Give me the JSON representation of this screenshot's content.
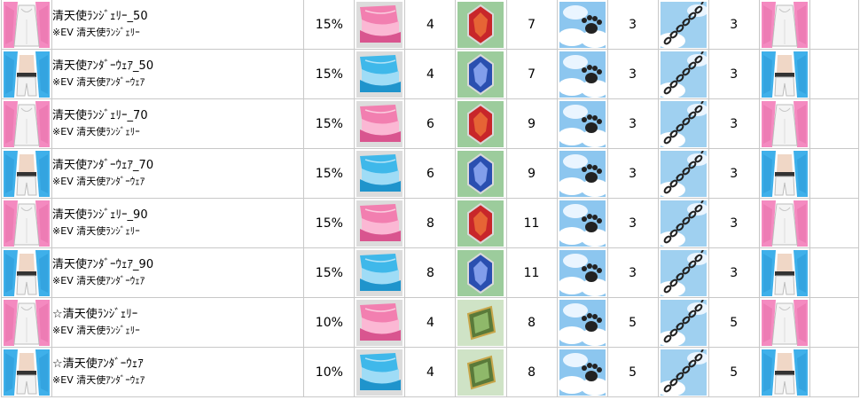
{
  "rows": [
    {
      "outfit": "pink-lingerie",
      "name": "清天使ﾗﾝｼﾞｪﾘｰ_50",
      "note": "※EV 清天使ﾗﾝｼﾞｪﾘｰ",
      "rate": "15%",
      "cloth": "pink",
      "cloth_qty": "4",
      "gem": "red",
      "gem_qty": "7",
      "paw_qty": "3",
      "chain_qty": "3"
    },
    {
      "outfit": "blue-underwear",
      "name": "清天使ｱﾝﾀﾞｰｳｪｱ_50",
      "note": "※EV 清天使ｱﾝﾀﾞｰｳｪｱ",
      "rate": "15%",
      "cloth": "blue",
      "cloth_qty": "4",
      "gem": "blue",
      "gem_qty": "7",
      "paw_qty": "3",
      "chain_qty": "3"
    },
    {
      "outfit": "pink-lingerie",
      "name": "清天使ﾗﾝｼﾞｪﾘｰ_70",
      "note": "※EV 清天使ﾗﾝｼﾞｪﾘｰ",
      "rate": "15%",
      "cloth": "pink",
      "cloth_qty": "6",
      "gem": "red",
      "gem_qty": "9",
      "paw_qty": "3",
      "chain_qty": "3"
    },
    {
      "outfit": "blue-underwear",
      "name": "清天使ｱﾝﾀﾞｰｳｪｱ_70",
      "note": "※EV 清天使ｱﾝﾀﾞｰｳｪｱ",
      "rate": "15%",
      "cloth": "blue",
      "cloth_qty": "6",
      "gem": "blue",
      "gem_qty": "9",
      "paw_qty": "3",
      "chain_qty": "3"
    },
    {
      "outfit": "pink-lingerie",
      "name": "清天使ﾗﾝｼﾞｪﾘｰ_90",
      "note": "※EV 清天使ﾗﾝｼﾞｪﾘｰ",
      "rate": "15%",
      "cloth": "pink",
      "cloth_qty": "8",
      "gem": "red",
      "gem_qty": "11",
      "paw_qty": "3",
      "chain_qty": "3"
    },
    {
      "outfit": "blue-underwear",
      "name": "清天使ｱﾝﾀﾞｰｳｪｱ_90",
      "note": "※EV 清天使ｱﾝﾀﾞｰｳｪｱ",
      "rate": "15%",
      "cloth": "blue",
      "cloth_qty": "8",
      "gem": "blue",
      "gem_qty": "11",
      "paw_qty": "3",
      "chain_qty": "3"
    },
    {
      "outfit": "pink-lingerie",
      "name": "☆清天使ﾗﾝｼﾞｪﾘｰ",
      "note": "※EV 清天使ﾗﾝｼﾞｪﾘｰ",
      "rate": "10%",
      "cloth": "pink",
      "cloth_qty": "4",
      "gem": "green",
      "gem_qty": "8",
      "paw_qty": "5",
      "chain_qty": "5"
    },
    {
      "outfit": "blue-underwear",
      "name": "☆清天使ｱﾝﾀﾞｰｳｪｱ",
      "note": "※EV 清天使ｱﾝﾀﾞｰｳｪｱ",
      "rate": "10%",
      "cloth": "blue",
      "cloth_qty": "4",
      "gem": "green",
      "gem_qty": "8",
      "paw_qty": "5",
      "chain_qty": "5"
    }
  ],
  "colors": {
    "border": "#c8c8c8",
    "pink_cloth": "#f27fb0",
    "blue_cloth": "#3fb8ea",
    "red_gem": "#c8262a",
    "blue_gem": "#2a4fb0",
    "green_gem": "#4e7a3c",
    "sky": "#8cc6ef"
  }
}
